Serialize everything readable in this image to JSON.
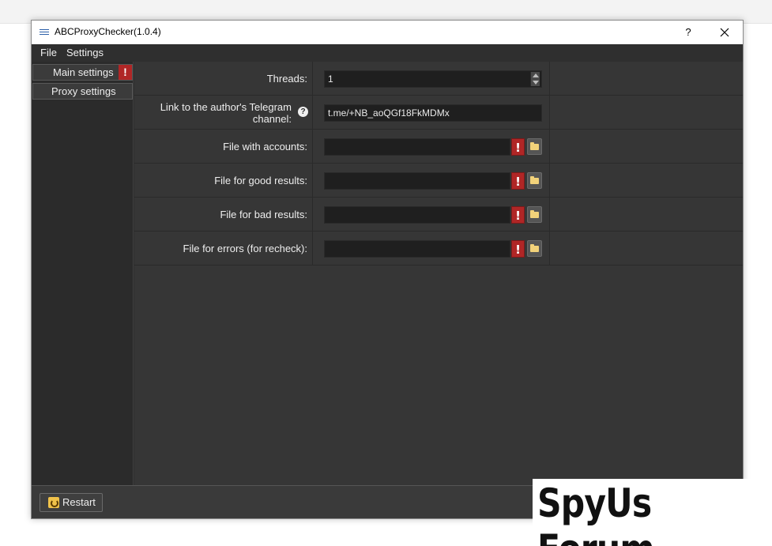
{
  "window": {
    "title": "ABCProxyChecker(1.0.4)",
    "help_label": "?"
  },
  "menu": {
    "items": [
      "File",
      "Settings"
    ]
  },
  "sidebar": {
    "items": [
      {
        "label": "Main settings",
        "warning": "!"
      },
      {
        "label": "Proxy settings"
      }
    ]
  },
  "settings": {
    "threads": {
      "label": "Threads:",
      "value": "1"
    },
    "telegram": {
      "label_line1": "Link to the author's Telegram",
      "label_line2": "channel:",
      "help": "?",
      "value": "t.me/+NB_aoQGf18FkMDMx"
    },
    "accounts_file": {
      "label": "File with accounts:",
      "value": "",
      "error": "!"
    },
    "good_file": {
      "label": "File for good results:",
      "value": "",
      "error": "!"
    },
    "bad_file": {
      "label": "File for bad results:",
      "value": "",
      "error": "!"
    },
    "errors_file": {
      "label": "File for errors (for recheck):",
      "value": "",
      "error": "!"
    }
  },
  "footer": {
    "restart_label": "Restart"
  },
  "watermark": {
    "text": "SpyUs Forum"
  },
  "colors": {
    "error_red": "#b02626",
    "folder_yellow": "#f2d27a",
    "window_dark": "#2f2f2f"
  },
  "icons": [
    "app-icon",
    "close-icon",
    "help-icon",
    "warning-icon",
    "folder-icon",
    "restart-icon",
    "spin-up-icon",
    "spin-down-icon"
  ]
}
